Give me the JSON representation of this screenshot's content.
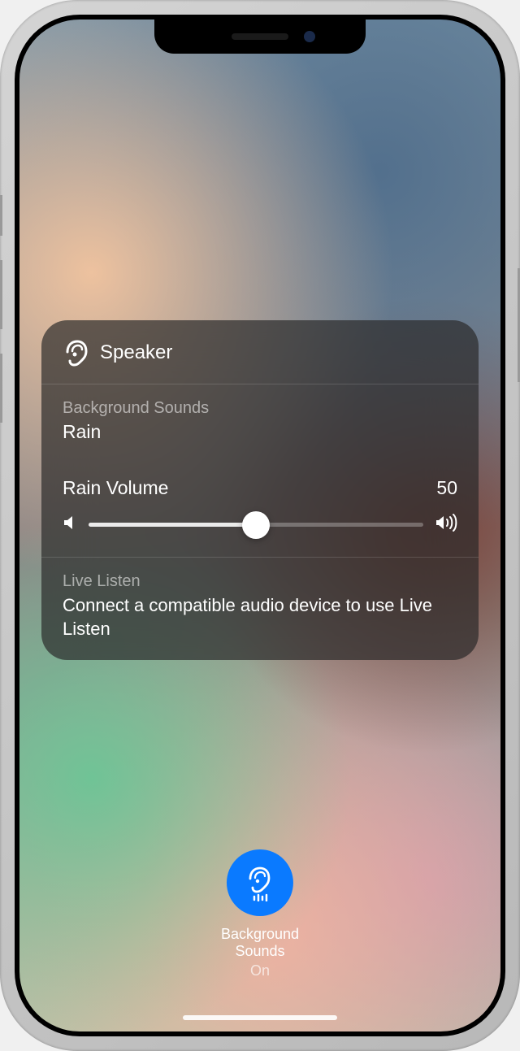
{
  "panel": {
    "title": "Speaker",
    "background_sounds": {
      "label": "Background Sounds",
      "value": "Rain"
    },
    "volume": {
      "label": "Rain Volume",
      "value": "50",
      "percent": 50
    },
    "live_listen": {
      "label": "Live Listen",
      "message": "Connect a compatible audio device to use Live Listen"
    }
  },
  "bottom_control": {
    "title_line1": "Background",
    "title_line2": "Sounds",
    "status": "On"
  },
  "colors": {
    "accent": "#0a7aff"
  }
}
